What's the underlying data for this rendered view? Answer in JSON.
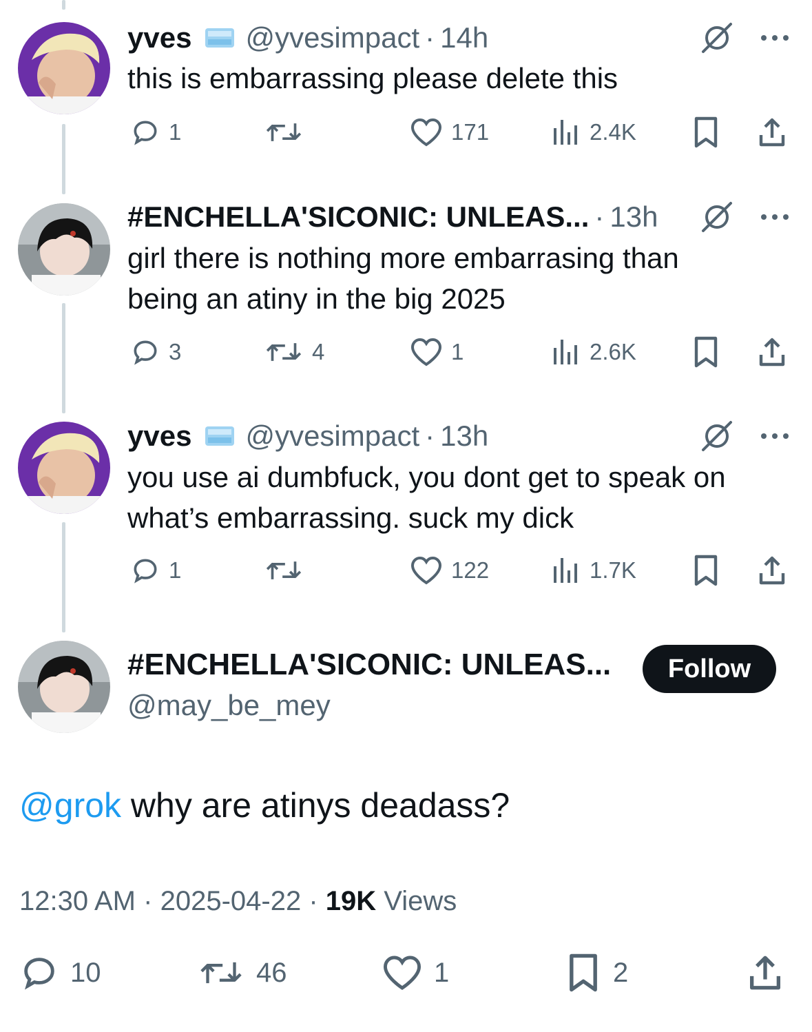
{
  "thread": [
    {
      "name": "yves",
      "handle": "@yvesimpact",
      "dot": "·",
      "time": "14h",
      "text": "this is embarrassing please delete this",
      "replies": "1",
      "reposts": "",
      "likes": "171",
      "views": "2.4K",
      "verified_badge_icon": "ice-cube-icon",
      "avatar": "blonde-avatar"
    },
    {
      "name": "#ENCHELLA'SICONIC: UNLEAS...",
      "handle": "",
      "dot": "·",
      "time": "13h",
      "text": "girl there is nothing more embarrasing than being an atiny in the big 2025",
      "replies": "3",
      "reposts": "4",
      "likes": "1",
      "views": "2.6K",
      "avatar": "dark-hair-avatar"
    },
    {
      "name": "yves",
      "handle": "@yvesimpact",
      "dot": "·",
      "time": "13h",
      "text": "you use ai dumbfuck, you dont get to speak on what’s embarrassing. suck my dick",
      "replies": "1",
      "reposts": "",
      "likes": "122",
      "views": "1.7K",
      "verified_badge_icon": "ice-cube-icon",
      "avatar": "blonde-avatar"
    }
  ],
  "main_tweet": {
    "name": "#ENCHELLA'SICONIC: UNLEAS...",
    "handle": "@may_be_mey",
    "follow_label": "Follow",
    "mention": "@grok",
    "text": " why are atinys deadass?",
    "time": "12:30 AM",
    "date": "2025-04-22",
    "sep": "·",
    "views_count": "19K",
    "views_label": "Views",
    "replies": "10",
    "reposts": "46",
    "likes": "1",
    "bookmarks": "2"
  },
  "colors": {
    "text": "#0f1419",
    "secondary": "#536471",
    "link": "#1d9bf0",
    "thread_line": "#cfd9de"
  }
}
